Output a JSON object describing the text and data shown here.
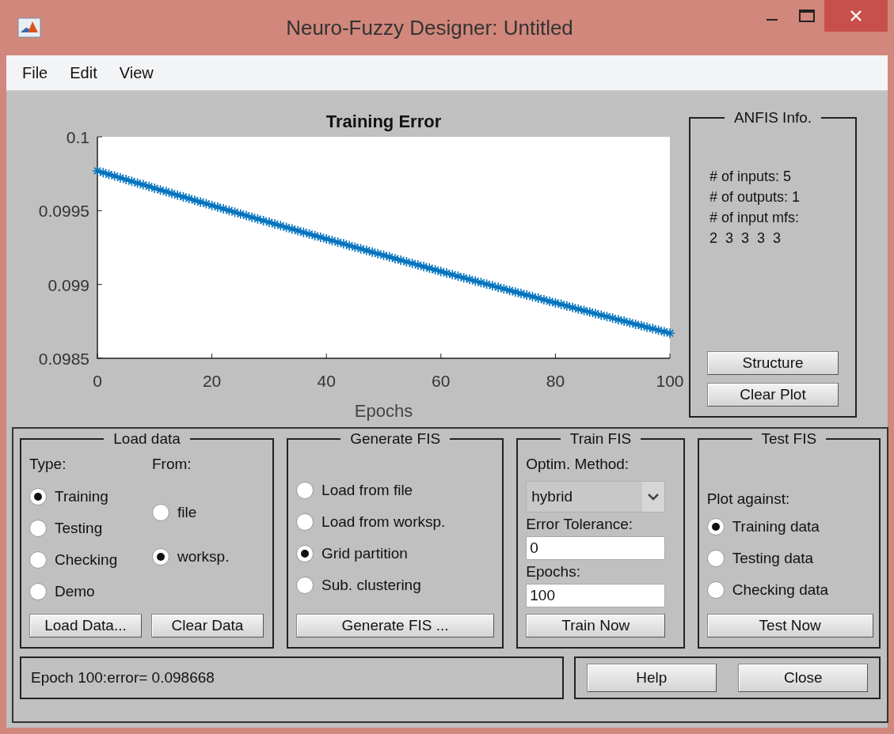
{
  "window": {
    "title": "Neuro-Fuzzy Designer: Untitled"
  },
  "menu": [
    "File",
    "Edit",
    "View"
  ],
  "plot": {
    "chart_data": {
      "type": "line",
      "title": "Training Error",
      "xlabel": "Epochs",
      "xlim": [
        0,
        100
      ],
      "ylim": [
        0.0985,
        0.1
      ],
      "xticks": [
        0,
        20,
        40,
        60,
        80,
        100
      ],
      "yticks": [
        {
          "value": 0.0985,
          "label": "0.0985"
        },
        {
          "value": 0.099,
          "label": "0.099"
        },
        {
          "value": 0.0995,
          "label": "0.0995"
        },
        {
          "value": 0.1,
          "label": "0.1"
        }
      ],
      "x": [
        0,
        1,
        2,
        3,
        4,
        5,
        6,
        7,
        8,
        9,
        10,
        11,
        12,
        13,
        14,
        15,
        16,
        17,
        18,
        19,
        20,
        21,
        22,
        23,
        24,
        25,
        26,
        27,
        28,
        29,
        30,
        31,
        32,
        33,
        34,
        35,
        36,
        37,
        38,
        39,
        40,
        41,
        42,
        43,
        44,
        45,
        46,
        47,
        48,
        49,
        50,
        51,
        52,
        53,
        54,
        55,
        56,
        57,
        58,
        59,
        60,
        61,
        62,
        63,
        64,
        65,
        66,
        67,
        68,
        69,
        70,
        71,
        72,
        73,
        74,
        75,
        76,
        77,
        78,
        79,
        80,
        81,
        82,
        83,
        84,
        85,
        86,
        87,
        88,
        89,
        90,
        91,
        92,
        93,
        94,
        95,
        96,
        97,
        98,
        99,
        100
      ],
      "series": [
        {
          "color": "#0072bd",
          "marker": "cross",
          "values": [
            0.09977,
            0.0997581,
            0.0997462,
            0.0997344,
            0.0997225,
            0.0997107,
            0.0996989,
            0.0996871,
            0.0996754,
            0.0996636,
            0.0996519,
            0.0996402,
            0.0996285,
            0.0996168,
            0.0996052,
            0.0995935,
            0.0995819,
            0.0995703,
            0.0995587,
            0.0995471,
            0.0995356,
            0.0995241,
            0.0995126,
            0.0995011,
            0.0994896,
            0.0994781,
            0.0994667,
            0.0994553,
            0.0994439,
            0.0994325,
            0.0994211,
            0.0994097,
            0.0993984,
            0.0993871,
            0.0993758,
            0.0993645,
            0.0993533,
            0.099342,
            0.0993308,
            0.0993196,
            0.0993084,
            0.0992972,
            0.0992861,
            0.0992749,
            0.0992638,
            0.0992527,
            0.0992416,
            0.0992306,
            0.0992195,
            0.0992085,
            0.0991975,
            0.0991865,
            0.0991755,
            0.0991646,
            0.0991536,
            0.0991427,
            0.0991318,
            0.0991209,
            0.0991101,
            0.0990992,
            0.0990884,
            0.0990776,
            0.0990668,
            0.099056,
            0.0990453,
            0.0990345,
            0.0990238,
            0.0990131,
            0.0990024,
            0.0989917,
            0.0989811,
            0.0989705,
            0.0989599,
            0.0989493,
            0.0989387,
            0.0989281,
            0.0989176,
            0.0989071,
            0.0988966,
            0.0988861,
            0.0988756,
            0.0988651,
            0.0988547,
            0.0988443,
            0.0988339,
            0.0988235,
            0.0988132,
            0.0988028,
            0.0987925,
            0.0987822,
            0.0987719,
            0.0987616,
            0.0987514,
            0.0987411,
            0.0987309,
            0.0987207,
            0.0987105,
            0.0987004,
            0.0986902,
            0.0986801,
            0.09867
          ]
        }
      ]
    }
  },
  "anfis_info": {
    "title": "ANFIS Info.",
    "lines": [
      "# of inputs: 5",
      "# of outputs: 1",
      "# of input mfs:",
      "2  3  3  3  3"
    ],
    "buttons": [
      "Structure",
      "Clear Plot"
    ]
  },
  "load_data": {
    "title": "Load data",
    "type_label": "Type:",
    "from_label": "From:",
    "type_options": [
      {
        "label": "Training",
        "selected": true
      },
      {
        "label": "Testing",
        "selected": false
      },
      {
        "label": "Checking",
        "selected": false
      },
      {
        "label": "Demo",
        "selected": false
      }
    ],
    "from_options": [
      {
        "label": "file",
        "selected": false
      },
      {
        "label": "worksp.",
        "selected": true
      }
    ],
    "buttons": [
      "Load Data...",
      "Clear Data"
    ]
  },
  "generate_fis": {
    "title": "Generate FIS",
    "options": [
      {
        "label": "Load from file",
        "selected": false
      },
      {
        "label": "Load from worksp.",
        "selected": false
      },
      {
        "label": "Grid partition",
        "selected": true
      },
      {
        "label": "Sub. clustering",
        "selected": false
      }
    ],
    "button": "Generate FIS ..."
  },
  "train_fis": {
    "title": "Train FIS",
    "method_label": "Optim. Method:",
    "method": "hybrid",
    "tolerance_label": "Error Tolerance:",
    "tolerance": "0",
    "epochs_label": "Epochs:",
    "epochs": "100",
    "button": "Train Now"
  },
  "test_fis": {
    "title": "Test FIS",
    "plot_label": "Plot against:",
    "options": [
      {
        "label": "Training data",
        "selected": true
      },
      {
        "label": "Testing data",
        "selected": false
      },
      {
        "label": "Checking data",
        "selected": false
      }
    ],
    "button": "Test Now"
  },
  "status": "Epoch 100:error= 0.098668",
  "buttons": [
    "Help",
    "Close"
  ]
}
